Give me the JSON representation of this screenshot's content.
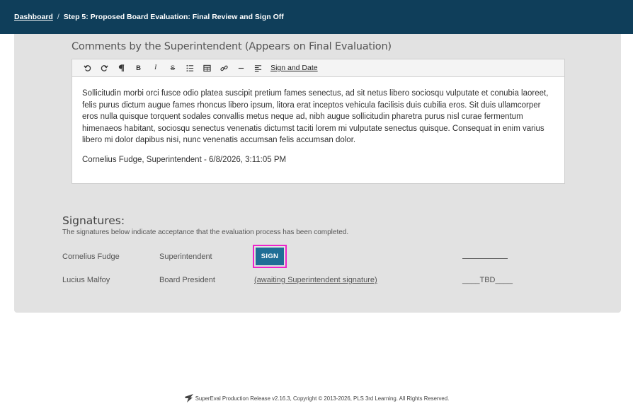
{
  "header": {
    "breadcrumb_root": "Dashboard",
    "separator": "/",
    "step_title": "Step 5: Proposed Board Evaluation: Final Review and Sign Off"
  },
  "comments": {
    "title": "Comments by the Superintendent (Appears on Final Evaluation)",
    "toolbar": {
      "sign_and_date": "Sign and Date",
      "icons": [
        "undo-icon",
        "redo-icon",
        "paragraph-icon",
        "bold-icon",
        "italic-icon",
        "strikethrough-icon",
        "bullet-list-icon",
        "table-icon",
        "link-icon",
        "horizontal-rule-icon",
        "align-icon"
      ]
    },
    "body_text": "Sollicitudin morbi orci fusce odio platea suscipit pretium fames senectus, ad sit netus libero sociosqu vulputate et conubia laoreet, felis purus dictum augue fames rhoncus libero ipsum, litora erat inceptos vehicula facilisis duis cubilia eros. Sit duis ullamcorper eros nulla quisque torquent sodales convallis metus neque ad, nibh augue sollicitudin pharetra purus nisl curae fermentum himenaeos habitant, sociosqu senectus venenatis dictumst taciti lorem mi vulputate senectus quisque. Consequat in enim varius libero mi dolor dapibus nisi, nunc venenatis accumsan felis accumsan dolor.",
    "signature_line": "Cornelius Fudge, Superintendent - 6/8/2026, 3:11:05 PM"
  },
  "signatures": {
    "title": "Signatures:",
    "subtitle": "The signatures below indicate acceptance that the evaluation process has been completed.",
    "rows": [
      {
        "name": "Cornelius Fudge",
        "role": "Superintendent",
        "action_label": "SIGN",
        "date": ""
      },
      {
        "name": "Lucius Malfoy",
        "role": "Board President",
        "action_label": "(awaiting Superintendent signature)",
        "date": "____TBD____"
      }
    ]
  },
  "footer": {
    "text": "SuperEval Production Release v2.16.3, Copyright © 2013-2026, PLS 3rd Learning. All Rights Reserved."
  },
  "colors": {
    "header_bg": "#0f3e5a",
    "panel_bg": "#e2e2e2",
    "sign_button": "#1f6e96",
    "highlight": "#ee22cc"
  }
}
